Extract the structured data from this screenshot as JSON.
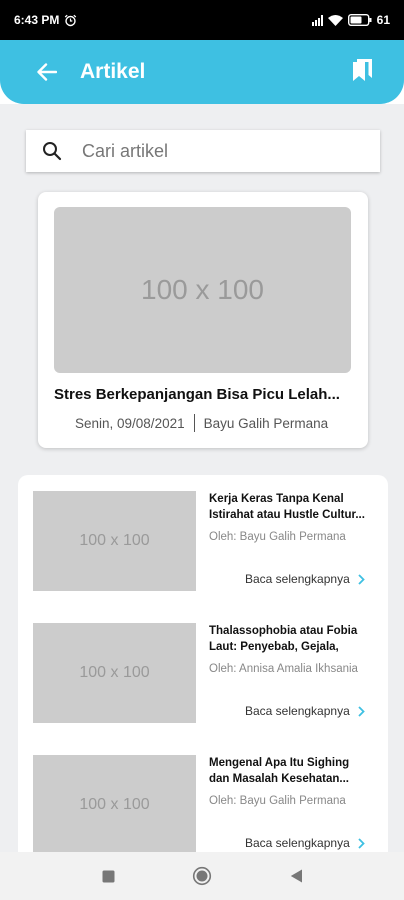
{
  "status_bar": {
    "time": "6:43 PM",
    "battery": "61",
    "icons": [
      "alarm-icon",
      "signal-icon",
      "wifi-icon",
      "battery-icon"
    ]
  },
  "app_bar": {
    "title": "Artikel",
    "back_icon": "arrow-left-icon",
    "bookmark_icon": "bookmarks-icon",
    "color": "#3ec0e2"
  },
  "search": {
    "placeholder": "Cari artikel",
    "value": ""
  },
  "featured": {
    "image_text": "100 x 100",
    "title": "Stres Berkepanjangan Bisa Picu Lelah...",
    "date": "Senin, 09/08/2021",
    "author": "Bayu Galih Permana"
  },
  "articles": [
    {
      "image_text": "100 x 100",
      "title": "Kerja Keras Tanpa Kenal Istirahat atau Hustle Cultur...",
      "author": "Oleh: Bayu Galih Permana",
      "more": "Baca selengkapnya"
    },
    {
      "image_text": "100 x 100",
      "title": "Thalassophobia atau Fobia Laut: Penyebab, Gejala, dan...",
      "author": "Oleh: Annisa Amalia Ikhsania",
      "more": "Baca selengkapnya"
    },
    {
      "image_text": "100 x 100",
      "title": "Mengenal Apa Itu Sighing dan Masalah Kesehatan...",
      "author": "Oleh: Bayu Galih Permana",
      "more": "Baca selengkapnya"
    }
  ],
  "nav_bar": {
    "icons": [
      "recents-square-icon",
      "home-circle-icon",
      "back-triangle-icon"
    ]
  }
}
